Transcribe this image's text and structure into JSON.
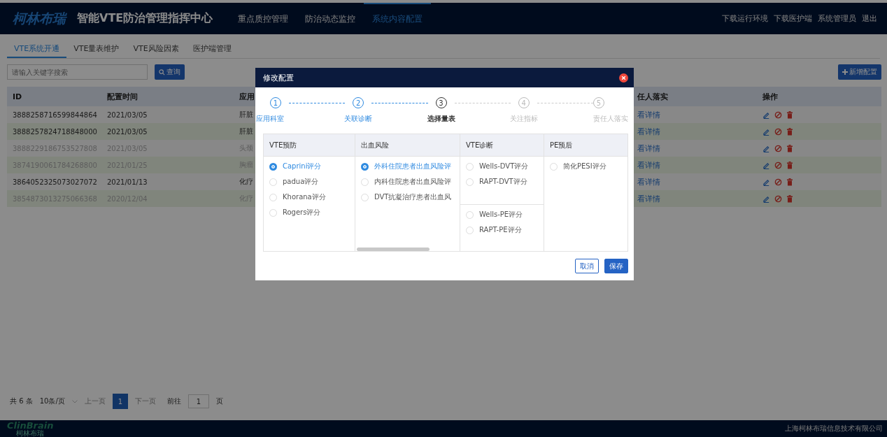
{
  "header": {
    "logo": "柯林布瑞",
    "title": "智能VTE防治管理指挥中心",
    "nav": [
      {
        "label": "重点质控管理",
        "selected": false
      },
      {
        "label": "防治动态监控",
        "selected": false
      },
      {
        "label": "系统内容配置",
        "selected": true
      }
    ],
    "links": [
      "下载运行环境",
      "下载医护端",
      "系统管理员",
      "退出"
    ]
  },
  "tabs": [
    {
      "label": "VTE系统开通",
      "selected": true
    },
    {
      "label": "VTE量表维护",
      "selected": false
    },
    {
      "label": "VTE风险因素",
      "selected": false
    },
    {
      "label": "医护端管理",
      "selected": false
    }
  ],
  "search": {
    "placeholder": "请输入关键字搜索",
    "button": "查询"
  },
  "add_button": "新增配置",
  "table": {
    "columns": [
      "ID",
      "配置时间",
      "应用",
      "任人落实",
      "操作"
    ],
    "rows": [
      {
        "id": "3888258716599844864",
        "time": "2021/03/05",
        "dept": "肝脏",
        "detail": "看详情",
        "disabled": false
      },
      {
        "id": "3888257824718848000",
        "time": "2021/03/05",
        "dept": "肝脏",
        "detail": "看详情",
        "disabled": false
      },
      {
        "id": "3888229186753527808",
        "time": "2021/03/05",
        "dept": "头颈",
        "detail": "看详情",
        "disabled": true
      },
      {
        "id": "3874190061784268800",
        "time": "2021/01/25",
        "dept": "胸瘤",
        "detail": "看详情",
        "disabled": true
      },
      {
        "id": "3864052325073027072",
        "time": "2021/01/13",
        "dept": "化疗",
        "detail": "看详情",
        "disabled": false
      },
      {
        "id": "3854873013275066368",
        "time": "2020/12/04",
        "dept": "化疗",
        "detail": "看详情",
        "disabled": true
      }
    ]
  },
  "pagination": {
    "total": "共 6 条",
    "page_size": "10条/页",
    "prev": "上一页",
    "pages": [
      {
        "label": "1",
        "selected": true
      }
    ],
    "next": "下一页",
    "goto": "前往",
    "goto_value": "1",
    "goto_suffix": "页"
  },
  "footer": {
    "logo": "ClinBrain",
    "logo_sub": "柯林布瑞",
    "company": "上海柯林布瑞信息技术有限公司"
  },
  "dialog": {
    "title": "修改配置",
    "steps": [
      {
        "number": "1",
        "label": "应用科室",
        "done": true,
        "current": false
      },
      {
        "number": "2",
        "label": "关联诊断",
        "done": true,
        "current": false
      },
      {
        "number": "3",
        "label": "选择量表",
        "done": false,
        "current": true
      },
      {
        "number": "4",
        "label": "关注指标",
        "done": false,
        "current": false
      },
      {
        "number": "5",
        "label": "责任人落实",
        "done": false,
        "current": false
      }
    ],
    "columns": [
      {
        "title": "VTE预防",
        "groups": [
          {
            "options": [
              {
                "label": "Caprini评分",
                "selected": true
              },
              {
                "label": "padua评分",
                "selected": false
              },
              {
                "label": "Khorana评分",
                "selected": false
              },
              {
                "label": "Rogers评分",
                "selected": false
              }
            ]
          }
        ]
      },
      {
        "title": "出血风险",
        "groups": [
          {
            "options": [
              {
                "label": "外科住院患者出血风险评",
                "selected": true
              },
              {
                "label": "内科住院患者出血风险评",
                "selected": false
              },
              {
                "label": "DVT抗凝治疗患者出血风",
                "selected": false
              }
            ]
          }
        ]
      },
      {
        "title": "VTE诊断",
        "groups": [
          {
            "options": [
              {
                "label": "Wells-DVT评分",
                "selected": false
              },
              {
                "label": "RAPT-DVT评分",
                "selected": false
              }
            ]
          },
          {
            "options": [
              {
                "label": "Wells-PE评分",
                "selected": false
              },
              {
                "label": "RAPT-PE评分",
                "selected": false
              }
            ]
          }
        ]
      },
      {
        "title": "PE预后",
        "groups": [
          {
            "options": [
              {
                "label": "简化PESI评分",
                "selected": false
              }
            ]
          }
        ]
      }
    ],
    "buttons": [
      {
        "label": "取消",
        "kind": "secondary"
      },
      {
        "label": "保存",
        "kind": "primary"
      }
    ]
  }
}
